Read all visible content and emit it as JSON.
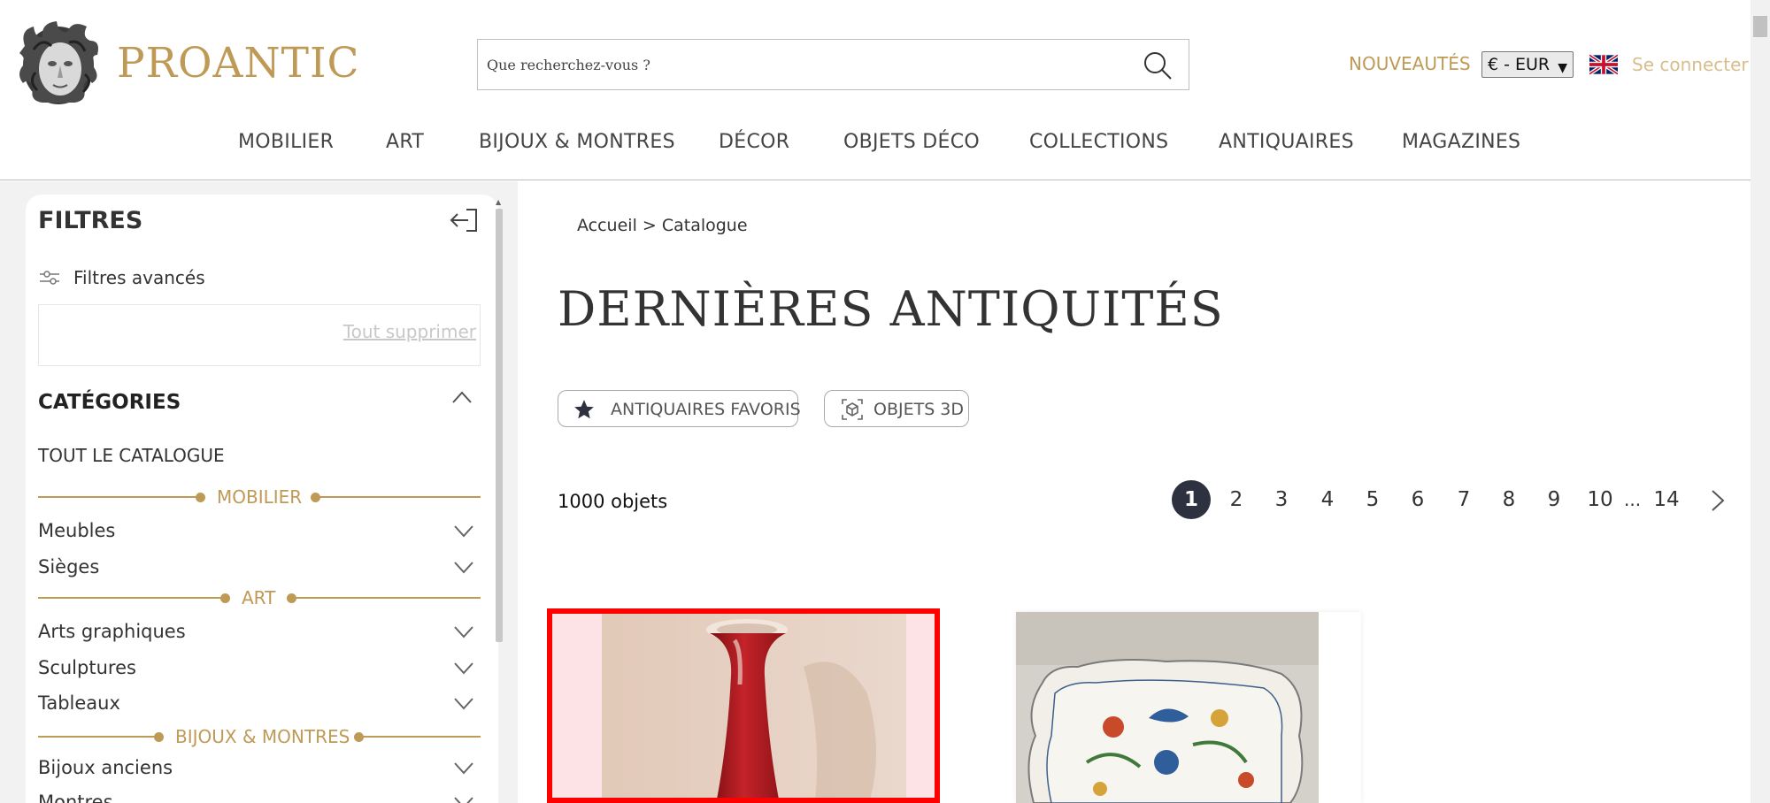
{
  "header": {
    "brand": "PROANTIC",
    "search_placeholder": "Que recherchez-vous ?",
    "nouveautes": "NOUVEAUTÉS",
    "currency": "€ - EUR",
    "login": "Se connecter",
    "nav": [
      "MOBILIER",
      "ART",
      "BIJOUX & MONTRES",
      "DÉCOR",
      "OBJETS DÉCO",
      "COLLECTIONS",
      "ANTIQUAIRES",
      "MAGAZINES"
    ]
  },
  "sidebar": {
    "title": "FILTRES",
    "advanced": "Filtres avancés",
    "clear_all": "Tout supprimer",
    "categories_title": "CATÉGORIES",
    "all_catalogue": "TOUT LE CATALOGUE",
    "groups": [
      {
        "label": "MOBILIER",
        "items": [
          "Meubles",
          "Sièges"
        ]
      },
      {
        "label": "ART",
        "items": [
          "Arts graphiques",
          "Sculptures",
          "Tableaux"
        ]
      },
      {
        "label": "BIJOUX & MONTRES",
        "items": [
          "Bijoux anciens",
          "Montres"
        ]
      }
    ]
  },
  "main": {
    "breadcrumb": "Accueil > Catalogue",
    "title": "DERNIÈRES ANTIQUITÉS",
    "pill_favorites": "ANTIQUAIRES FAVORIS",
    "pill_3d": "OBJETS 3D",
    "count": "1000 objets",
    "pagination": {
      "pages": [
        "1",
        "2",
        "3",
        "4",
        "5",
        "6",
        "7",
        "8",
        "9",
        "10"
      ],
      "ellipsis": "...",
      "last": "14",
      "current": "1"
    }
  },
  "colors": {
    "gold": "#bf9a56",
    "active_page": "#2e3140",
    "highlight": "#ff0000"
  },
  "icons": [
    "medusa-logo-icon",
    "search-icon",
    "uk-flag-icon",
    "collapse-panel-icon",
    "sliders-icon",
    "chevron-up-icon",
    "chevron-down-icon",
    "star-icon",
    "cube-3d-icon",
    "chevron-right-icon"
  ]
}
